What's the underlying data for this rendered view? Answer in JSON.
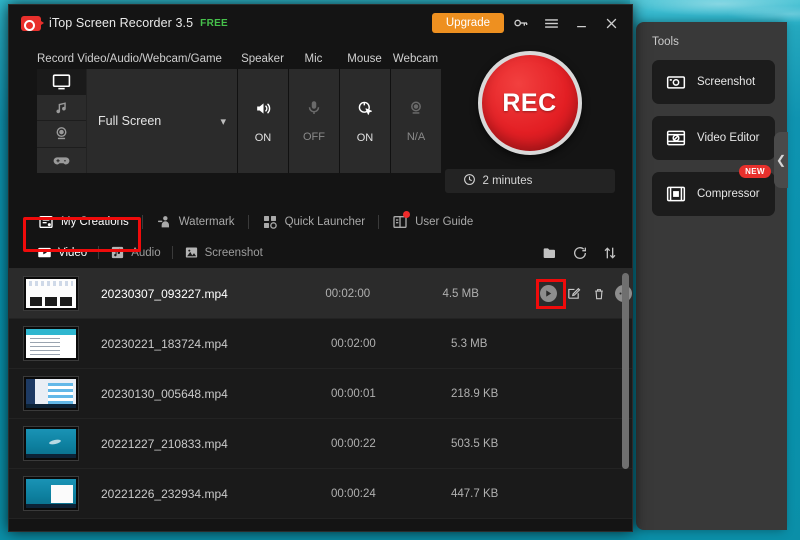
{
  "window": {
    "title": "iTop Screen Recorder 3.5",
    "free_badge": "FREE",
    "logo_icon": "recorder-logo-icon",
    "upgrade_label": "Upgrade",
    "key_icon": "key-icon",
    "menu_icon": "hamburger-menu-icon",
    "minimize_icon": "minimize-icon",
    "close_icon": "close-icon"
  },
  "record": {
    "source_header": "Record Video/Audio/Webcam/Game",
    "source_value": "Full Screen",
    "source_chevron_icon": "chevron-down-icon",
    "source_modes": [
      {
        "name": "monitor-icon",
        "label": "Screen",
        "active": true
      },
      {
        "name": "music-note-icon",
        "label": "Audio",
        "active": false
      },
      {
        "name": "webcam-icon",
        "label": "Webcam",
        "active": false
      },
      {
        "name": "gamepad-icon",
        "label": "Game",
        "active": false
      }
    ],
    "devices": [
      {
        "header": "Speaker",
        "icon": "speaker-icon",
        "state": "ON",
        "status": "on"
      },
      {
        "header": "Mic",
        "icon": "microphone-icon",
        "state": "OFF",
        "status": "off"
      },
      {
        "header": "Mouse",
        "icon": "mouse-click-icon",
        "state": "ON",
        "status": "on"
      },
      {
        "header": "Webcam",
        "icon": "webcam-icon",
        "state": "N/A",
        "status": "na"
      }
    ],
    "rec_label": "REC",
    "timer_icon": "clock-icon",
    "timer_label": "2 minutes"
  },
  "features": [
    {
      "label": "My Creations",
      "icon": "my-creations-icon",
      "active": true,
      "new": false
    },
    {
      "label": "Watermark",
      "icon": "watermark-icon",
      "active": false,
      "new": false
    },
    {
      "label": "Quick Launcher",
      "icon": "quick-launcher-icon",
      "active": false,
      "new": false
    },
    {
      "label": "User Guide",
      "icon": "user-guide-icon",
      "active": false,
      "new": true
    }
  ],
  "list_tabs": [
    {
      "label": "Video",
      "icon": "video-icon",
      "active": true
    },
    {
      "label": "Audio",
      "icon": "audio-icon",
      "active": false
    },
    {
      "label": "Screenshot",
      "icon": "screenshot-icon",
      "active": false
    }
  ],
  "list_tools": [
    {
      "name": "open-folder-icon"
    },
    {
      "name": "refresh-icon"
    },
    {
      "name": "sort-icon"
    }
  ],
  "files": [
    {
      "name": "20230307_093227.mp4",
      "duration": "00:02:00",
      "size": "4.5 MB",
      "thumb": "t-slide",
      "selected": true
    },
    {
      "name": "20230221_183724.mp4",
      "duration": "00:02:00",
      "size": "5.3 MB",
      "thumb": "t-doc",
      "selected": false
    },
    {
      "name": "20230130_005648.mp4",
      "duration": "00:00:01",
      "size": "218.9 KB",
      "thumb": "t-win",
      "selected": false
    },
    {
      "name": "20221227_210833.mp4",
      "duration": "00:00:22",
      "size": "503.5 KB",
      "thumb": "t-sea",
      "selected": false
    },
    {
      "name": "20221226_232934.mp4",
      "duration": "00:00:24",
      "size": "447.7 KB",
      "thumb": "t-sea-menu",
      "selected": false
    }
  ],
  "row_actions": [
    {
      "name": "play-icon",
      "highlighted": false
    },
    {
      "name": "edit-icon",
      "highlighted": true
    },
    {
      "name": "delete-icon",
      "highlighted": false
    },
    {
      "name": "more-icon",
      "highlighted": false
    }
  ],
  "tools": {
    "title": "Tools",
    "collapse_icon": "chevron-left-icon",
    "items": [
      {
        "label": "Screenshot",
        "icon": "camera-icon",
        "badge": ""
      },
      {
        "label": "Video Editor",
        "icon": "video-edit-icon",
        "badge": ""
      },
      {
        "label": "Compressor",
        "icon": "compressor-icon",
        "badge": "NEW"
      }
    ]
  },
  "highlights": {
    "my_creations_color": "#ef0b0b",
    "edit_button_color": "#ef0b0b"
  },
  "colors": {
    "accent_orange": "#ee9020",
    "rec_red": "#e31f24",
    "free_green": "#46c14b",
    "desktop_teal": "#0f93b0"
  }
}
